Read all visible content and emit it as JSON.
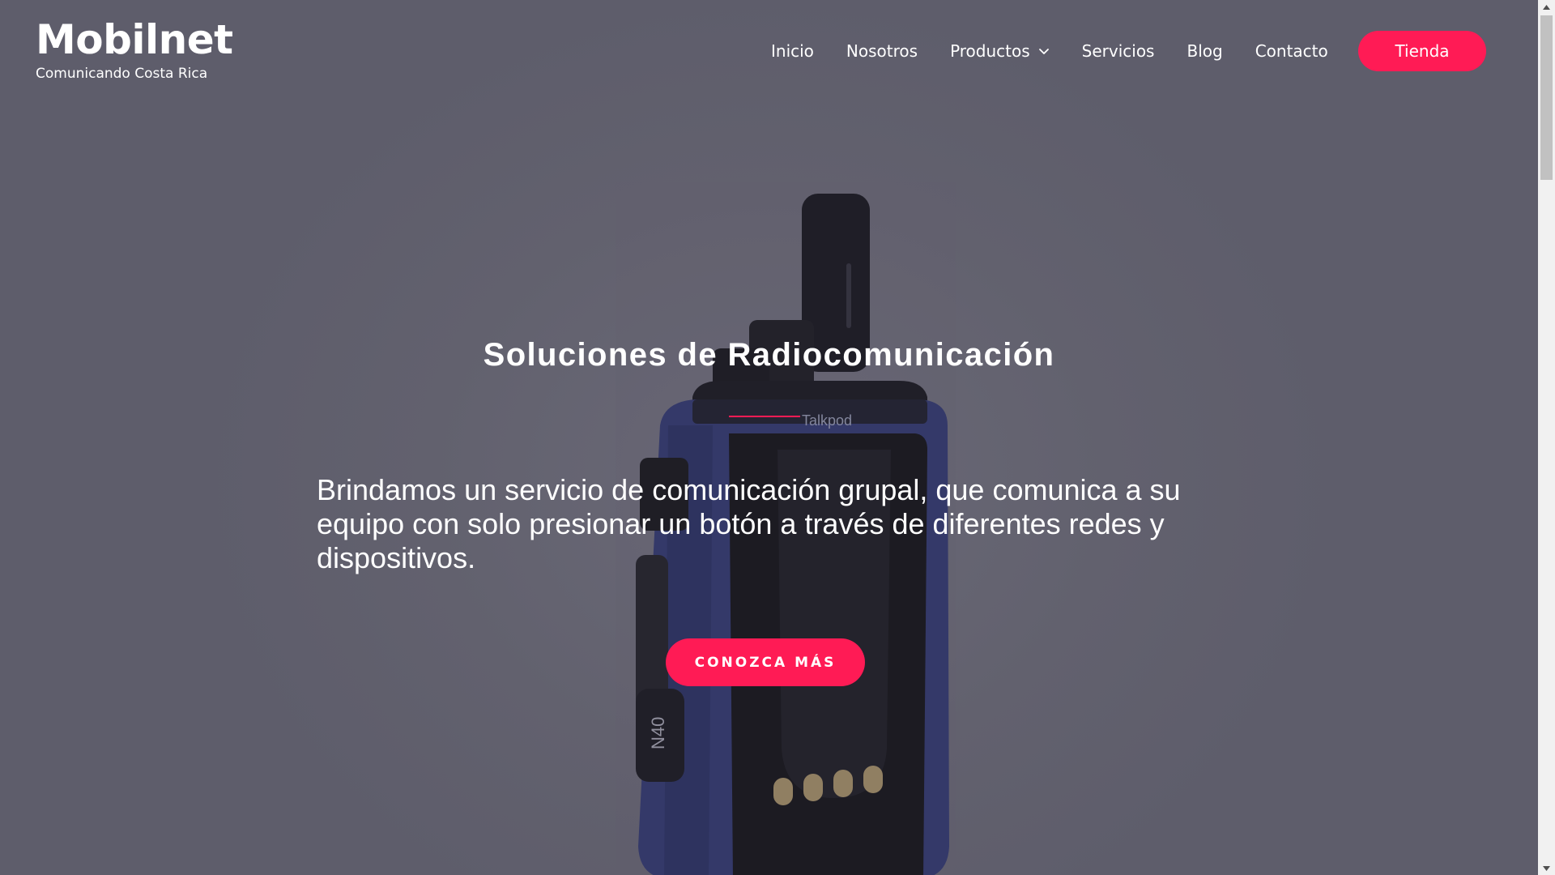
{
  "header": {
    "brand_title": "Mobilnet",
    "brand_tagline": "Comunicando Costa Rica",
    "nav": [
      {
        "label": "Inicio"
      },
      {
        "label": "Nosotros"
      },
      {
        "label": "Productos",
        "icon": "chevron-down-icon"
      },
      {
        "label": "Servicios"
      },
      {
        "label": "Blog"
      },
      {
        "label": "Contacto"
      }
    ],
    "shop_label": "Tienda"
  },
  "hero": {
    "title": "Soluciones de Radiocomunicación",
    "text": "Brindamos un servicio de comunicación grupal, que comunica a su equipo con solo presionar un botón a través de diferentes redes y dispositivos.",
    "cta_label": "CONOZCA MÁS",
    "radio_brand": "Talkpod",
    "radio_model": "N40"
  },
  "colors": {
    "accent": "#ff1b55",
    "overlay": "#62616f",
    "text": "#ffffff"
  }
}
